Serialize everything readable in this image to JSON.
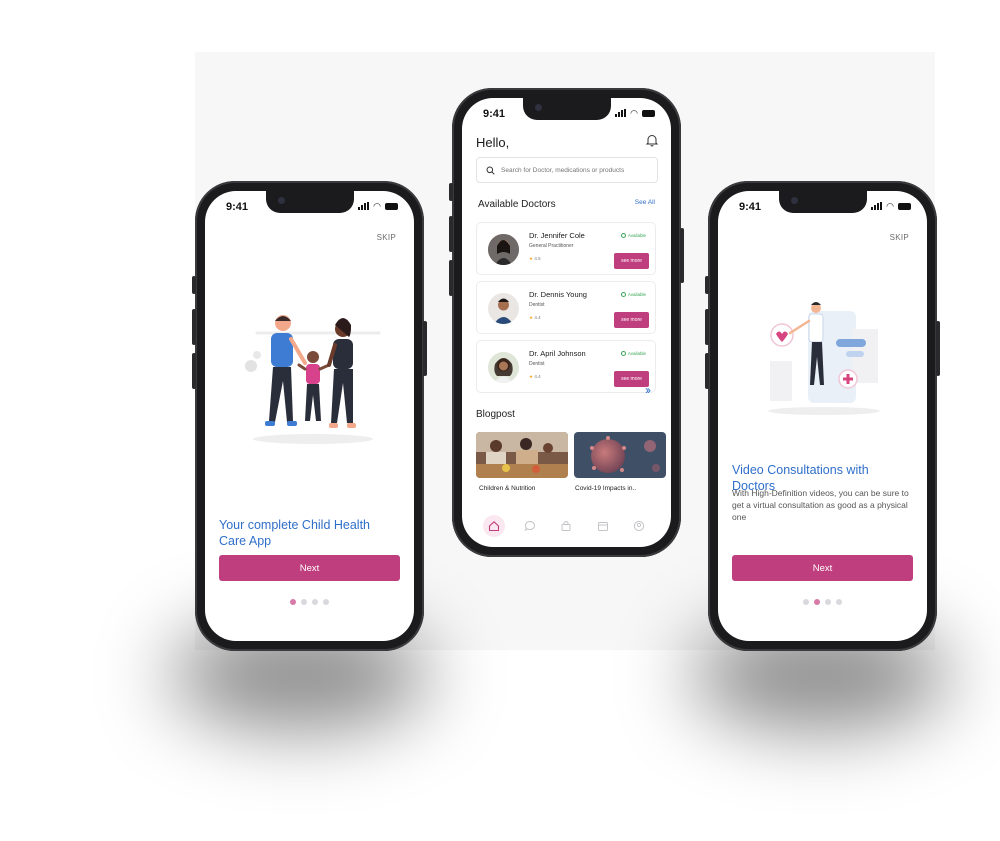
{
  "status_bar": {
    "time": "9:41"
  },
  "onboarding_left": {
    "skip_label": "SKIP",
    "title": "Your complete Child Health Care App",
    "next_label": "Next",
    "dots": [
      true,
      false,
      false,
      false
    ]
  },
  "home": {
    "greeting": "Hello,",
    "search": {
      "placeholder": "Search for Doctor, medications or products"
    },
    "available_doctors_title": "Available Doctors",
    "see_all_label": "See All",
    "doctors": [
      {
        "name": "Dr. Jennifer Cole",
        "specialty": "General Practitioner",
        "rating": "4.5",
        "status": "Available",
        "action": "see more"
      },
      {
        "name": "Dr. Dennis Young",
        "specialty": "Dentist",
        "rating": "4.4",
        "status": "Available",
        "action": "see more"
      },
      {
        "name": "Dr. April Johnson",
        "specialty": "Dentist",
        "rating": "4.4",
        "status": "Available",
        "action": "see more"
      }
    ],
    "blogpost_title": "Blogpost",
    "blog_arrow": "››",
    "blogs": [
      {
        "caption": "Children & Nutrition"
      },
      {
        "caption": "Covid-19 Impacts in.."
      }
    ],
    "tabs": [
      "home-icon",
      "chat-icon",
      "bag-icon",
      "calendar-icon",
      "profile-icon"
    ]
  },
  "onboarding_right": {
    "skip_label": "SKIP",
    "title": "Video Consultations with Doctors",
    "description": "With High-Definition videos, you can be sure to get a virtual consultation as good as a physical one",
    "next_label": "Next",
    "dots": [
      false,
      true,
      false,
      false
    ]
  },
  "colors": {
    "accent": "#bf3e7e",
    "title_blue": "#2f6fc9",
    "available_green": "#3aa655"
  }
}
